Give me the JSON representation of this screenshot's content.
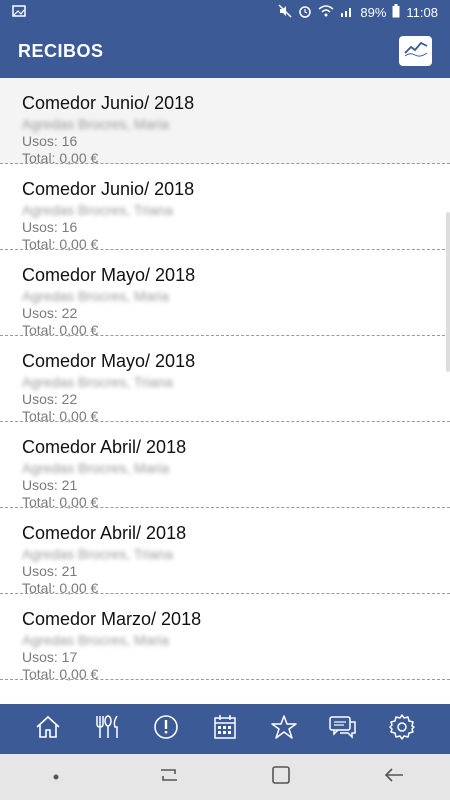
{
  "status": {
    "battery": "89%",
    "time": "11:08"
  },
  "appbar": {
    "title": "RECIBOS"
  },
  "receipts": [
    {
      "title": "Comedor Junio/ 2018",
      "name": "Agredas Brocres, Maria",
      "uses": "Usos: 16",
      "total": "Total: 0,00 €"
    },
    {
      "title": "Comedor Junio/ 2018",
      "name": "Agredas Brocres, Triana",
      "uses": "Usos: 16",
      "total": "Total: 0,00 €"
    },
    {
      "title": "Comedor Mayo/ 2018",
      "name": "Agredas Brocres, Maria",
      "uses": "Usos: 22",
      "total": "Total: 0,00 €"
    },
    {
      "title": "Comedor Mayo/ 2018",
      "name": "Agredas Brocres, Triana",
      "uses": "Usos: 22",
      "total": "Total: 0,00 €"
    },
    {
      "title": "Comedor Abril/ 2018",
      "name": "Agredas Brocres, Maria",
      "uses": "Usos: 21",
      "total": "Total: 0,00 €"
    },
    {
      "title": "Comedor Abril/ 2018",
      "name": "Agredas Brocres, Triana",
      "uses": "Usos: 21",
      "total": "Total: 0,00 €"
    },
    {
      "title": "Comedor Marzo/ 2018",
      "name": "Agredas Brocres, Maria",
      "uses": "Usos: 17",
      "total": "Total: 0,00 €"
    }
  ],
  "tabs": [
    "home-icon",
    "cutlery-icon",
    "alert-icon",
    "calendar-icon",
    "star-icon",
    "chat-icon",
    "gear-icon"
  ],
  "colors": {
    "primary": "#3b5a96",
    "divider": "#9a9a9a"
  }
}
